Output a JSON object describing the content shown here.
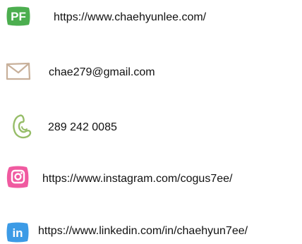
{
  "contacts": {
    "website": {
      "icon": "portfolio-icon",
      "icon_text": "PF",
      "label": "https://www.chaehyunlee.com/",
      "color": "#4cae4f"
    },
    "email": {
      "icon": "envelope-icon",
      "label": "chae279@gmail.com",
      "color": "#c8b09a"
    },
    "phone": {
      "icon": "phone-icon",
      "label": "289 242 0085",
      "color": "#96bd68"
    },
    "instagram": {
      "icon": "instagram-icon",
      "label": "https://www.instagram.com/cogus7ee/",
      "color": "#f05aa0"
    },
    "linkedin": {
      "icon": "linkedin-icon",
      "icon_text": "in",
      "label": "https://www.linkedin.com/in/chaehyun7ee/",
      "color": "#3c9be6"
    }
  }
}
